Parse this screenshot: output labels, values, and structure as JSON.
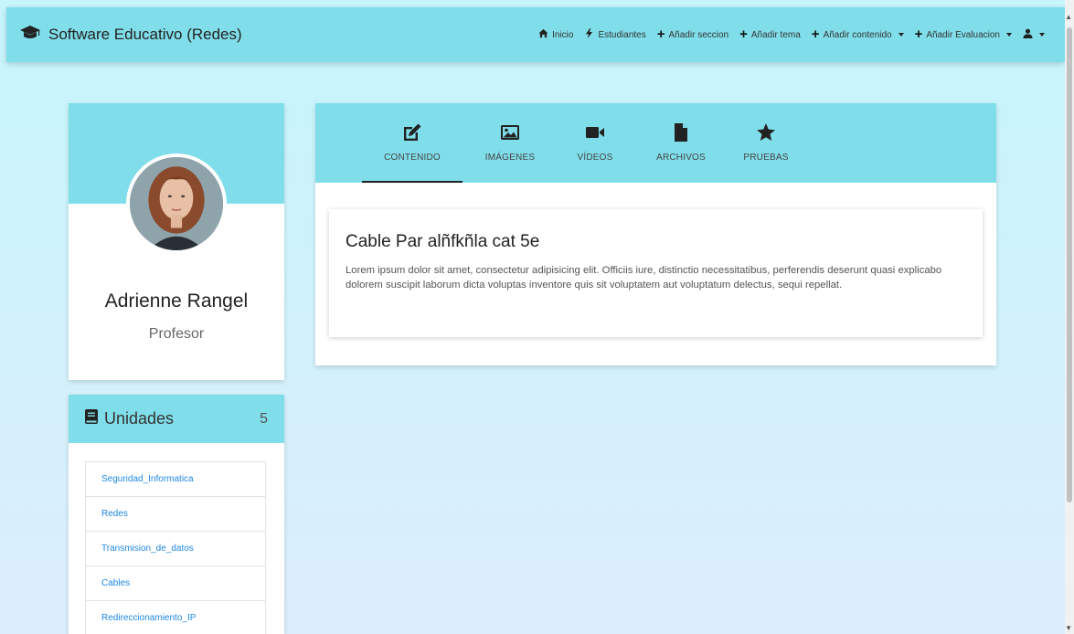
{
  "brand": {
    "title": "Software Educativo (Redes)",
    "icon": "graduation-cap-icon"
  },
  "nav": {
    "items": [
      {
        "label": "Inicio",
        "icon": "home-icon"
      },
      {
        "label": "Estudiantes",
        "icon": "bolt-icon"
      },
      {
        "label": "Añadir seccion",
        "icon": "plus-icon"
      },
      {
        "label": "Añadir tema",
        "icon": "plus-icon"
      },
      {
        "label": "Añadir contenido",
        "icon": "plus-icon",
        "dropdown": true
      },
      {
        "label": "Añadir Evaluacion",
        "icon": "plus-icon",
        "dropdown": true
      }
    ],
    "user_icon": "user-icon"
  },
  "profile": {
    "name": "Adrienne Rangel",
    "role": "Profesor"
  },
  "units": {
    "title": "Unidades",
    "count": "5",
    "icon": "book-icon",
    "items": [
      {
        "label": "Seguridad_Informatica"
      },
      {
        "label": "Redes"
      },
      {
        "label": "Transmision_de_datos"
      },
      {
        "label": "Cables"
      },
      {
        "label": "Redireccionamiento_IP"
      }
    ]
  },
  "tabs": [
    {
      "label": "Contenido",
      "icon": "edit-icon",
      "active": true
    },
    {
      "label": "Imágenes",
      "icon": "image-icon"
    },
    {
      "label": "Vídeos",
      "icon": "video-icon"
    },
    {
      "label": "Archivos",
      "icon": "file-icon"
    },
    {
      "label": "Pruebas",
      "icon": "star-icon"
    }
  ],
  "content": {
    "title": "Cable Par alñfkñla cat 5e",
    "body": "Lorem ipsum dolor sit amet, consectetur adipisicing elit. Officiis iure, distinctio necessitatibus, perferendis deserunt quasi explicabo dolorem suscipit laborum dicta voluptas inventore quis sit voluptatem aut voluptatum delectus, sequi repellat."
  },
  "colors": {
    "accent": "#80deea",
    "link": "#1e88e5",
    "background": "#c6f5fb"
  }
}
